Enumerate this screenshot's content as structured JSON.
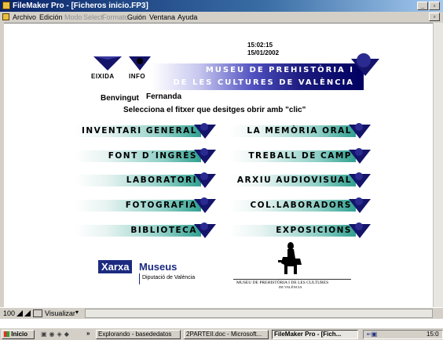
{
  "window": {
    "title": "FileMaker Pro - [Ficheros inicio.FP3]"
  },
  "menubar": {
    "items": [
      "Archivo",
      "Edición",
      "Modo",
      "Select",
      "Formato",
      "Guión",
      "Ventana",
      "Ayuda"
    ]
  },
  "header": {
    "time": "15:02:15",
    "date": "15/01/2002",
    "exit_label": "EIXIDA",
    "info_label": "INFO",
    "title_line1": "MUSEU DE PREHISTÒRIA I",
    "title_line2": "DE LES CULTURES DE VALÈNCIA"
  },
  "welcome": {
    "greeting": "Benvingut",
    "user": "Fernanda",
    "instruction": "Selecciona el fitxer que desitges obrir amb \"clic\""
  },
  "files": {
    "left": [
      "INVENTARI GENERAL",
      "FONT D´INGRÉS",
      "LABORATORI",
      "FOTOGRAFIA",
      "BIBLIOTECA"
    ],
    "right": [
      "LA MEMÒRIA ORAL",
      "TREBALL DE CAMP",
      "ARXIU AUDIOVISUAL",
      "COL.LABORADORS",
      "EXPOSICIONS"
    ]
  },
  "logos": {
    "xarxa_1": "Xarxa",
    "xarxa_2": "Museus",
    "xarxa_sub": "Diputació de València",
    "museum_caption": "MUSEU DE PREHISTÒRIA I DE LES CULTURES",
    "museum_caption_2": "DE VALÈNCIA"
  },
  "statusbar": {
    "zoom": "100",
    "mode": "Visualizar"
  },
  "taskbar": {
    "start": "Inicio",
    "tasks": [
      "Explorando - basededatos",
      "2PARTEII.doc - Microsoft...",
      "FileMaker Pro - [Fich..."
    ],
    "clock": "15:0"
  },
  "colors": {
    "accent_teal": "#30a090",
    "title_navy": "#000060",
    "arrow_navy": "#14146a"
  }
}
